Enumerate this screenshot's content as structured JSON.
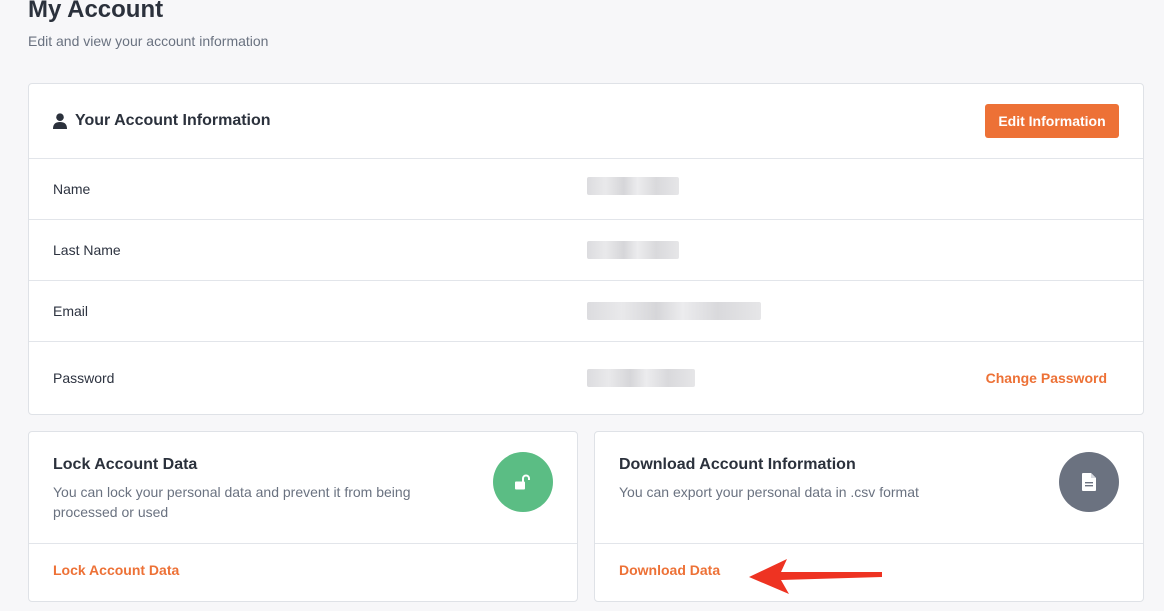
{
  "page": {
    "title": "My Account",
    "subtitle": "Edit and view your account information"
  },
  "info_card": {
    "title": "Your Account Information",
    "edit_button": "Edit Information",
    "rows": [
      {
        "label": "Name"
      },
      {
        "label": "Last Name"
      },
      {
        "label": "Email"
      },
      {
        "label": "Password",
        "action": "Change Password"
      }
    ]
  },
  "lock_card": {
    "title": "Lock Account Data",
    "description": "You can lock your personal data and prevent it from being processed or used",
    "link": "Lock Account Data",
    "icon": "unlock-icon"
  },
  "download_card": {
    "title": "Download Account Information",
    "description": "You can export your personal data in .csv format",
    "link": "Download Data",
    "icon": "document-icon"
  },
  "colors": {
    "accent": "#ed7136",
    "lock_green": "#5bbd84",
    "doc_gray": "#6b7280",
    "arrow_red": "#ee3322"
  }
}
